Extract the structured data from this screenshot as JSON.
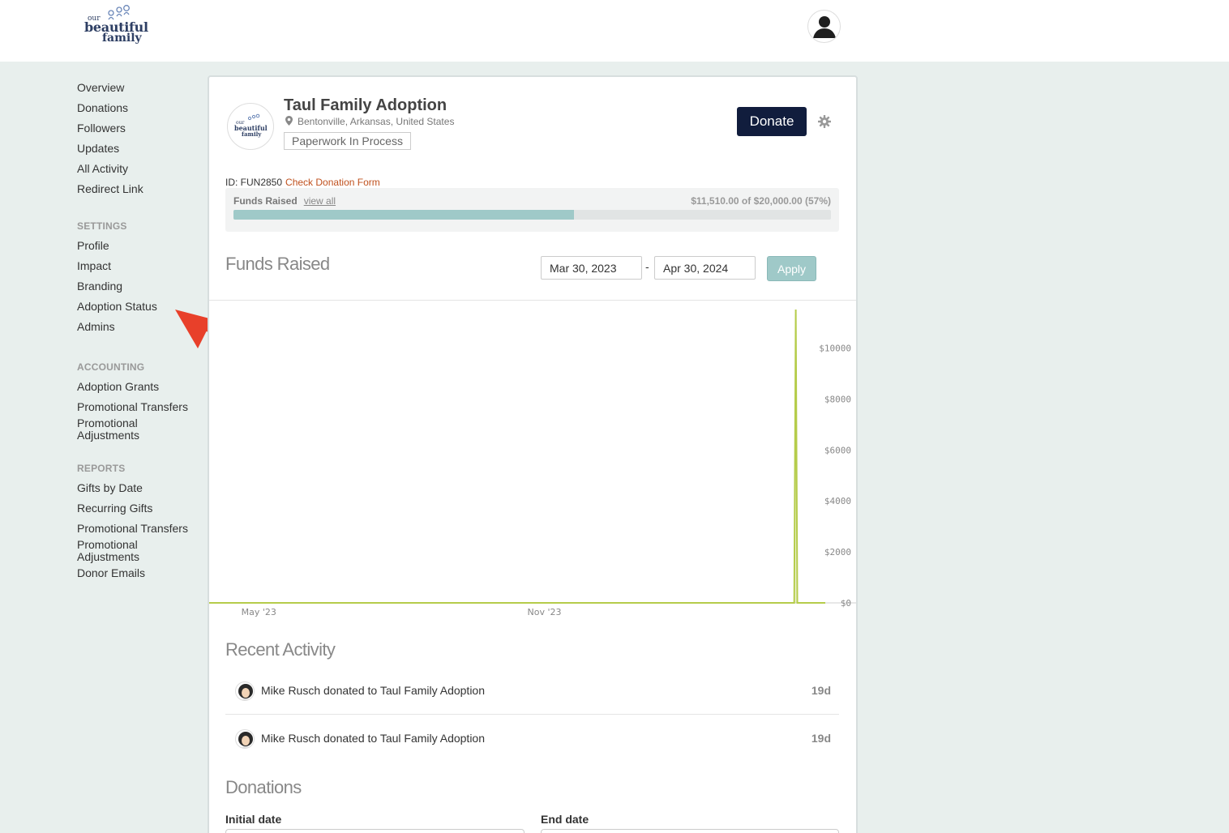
{
  "header": {
    "logo": {
      "line1": "our",
      "line2": "beautiful",
      "line3": "family"
    },
    "user_icon": "user-icon"
  },
  "sidebar": {
    "main_items": [
      "Overview",
      "Donations",
      "Followers",
      "Updates",
      "All Activity",
      "Redirect Link"
    ],
    "settings_heading": "SETTINGS",
    "settings_items": [
      "Profile",
      "Impact",
      "Branding",
      "Adoption Status",
      "Admins"
    ],
    "accounting_heading": "ACCOUNTING",
    "accounting_items": [
      "Adoption Grants",
      "Promotional Transfers",
      "Promotional\nAdjustments"
    ],
    "reports_heading": "REPORTS",
    "reports_items": [
      "Gifts by Date",
      "Recurring Gifts",
      "Promotional Transfers",
      "Promotional\nAdjustments",
      "Donor Emails"
    ]
  },
  "annotation": {
    "color": "#e8402a",
    "icon": "arrow-icon"
  },
  "profile": {
    "name": "Taul Family Adoption",
    "location": "Bentonville, Arkansas, United States",
    "status": "Paperwork In Process",
    "donate_label": "Donate",
    "settings_icon": "gear-icon",
    "id_text": "ID: FUN2850",
    "check_form_link": "Check Donation Form"
  },
  "funds": {
    "label": "Funds Raised",
    "view_all": "view all",
    "amount_text": "$11,510.00 of $20,000.00 (57%)",
    "progress_percent": 57
  },
  "chart_section": {
    "title": "Funds Raised",
    "start_date": "Mar 30, 2023",
    "dash": "-",
    "end_date": "Apr 30, 2024",
    "apply_label": "Apply"
  },
  "chart_data": {
    "type": "area",
    "x_ticks": [
      "May '23",
      "Nov '23"
    ],
    "y_ticks": [
      "$10000",
      "$8000",
      "$6000",
      "$4000",
      "$2000",
      "$0"
    ],
    "y_tick_values": [
      10000,
      8000,
      6000,
      4000,
      2000,
      0
    ],
    "ylim": [
      0,
      11510
    ],
    "x": [
      "Mar 30, 2023",
      "Apr 10, 2024",
      "Apr 11, 2024",
      "Apr 12, 2024",
      "Apr 30, 2024"
    ],
    "values": [
      0,
      0,
      11510,
      0,
      0
    ],
    "series_color": "#b5cc4a"
  },
  "recent_activity": {
    "title": "Recent Activity",
    "items": [
      {
        "text": "Mike Rusch donated to Taul Family Adoption",
        "ago": "19d"
      },
      {
        "text": "Mike Rusch donated to Taul Family Adoption",
        "ago": "19d"
      }
    ]
  },
  "donations": {
    "title": "Donations",
    "initial_label": "Initial date",
    "end_label": "End date"
  }
}
